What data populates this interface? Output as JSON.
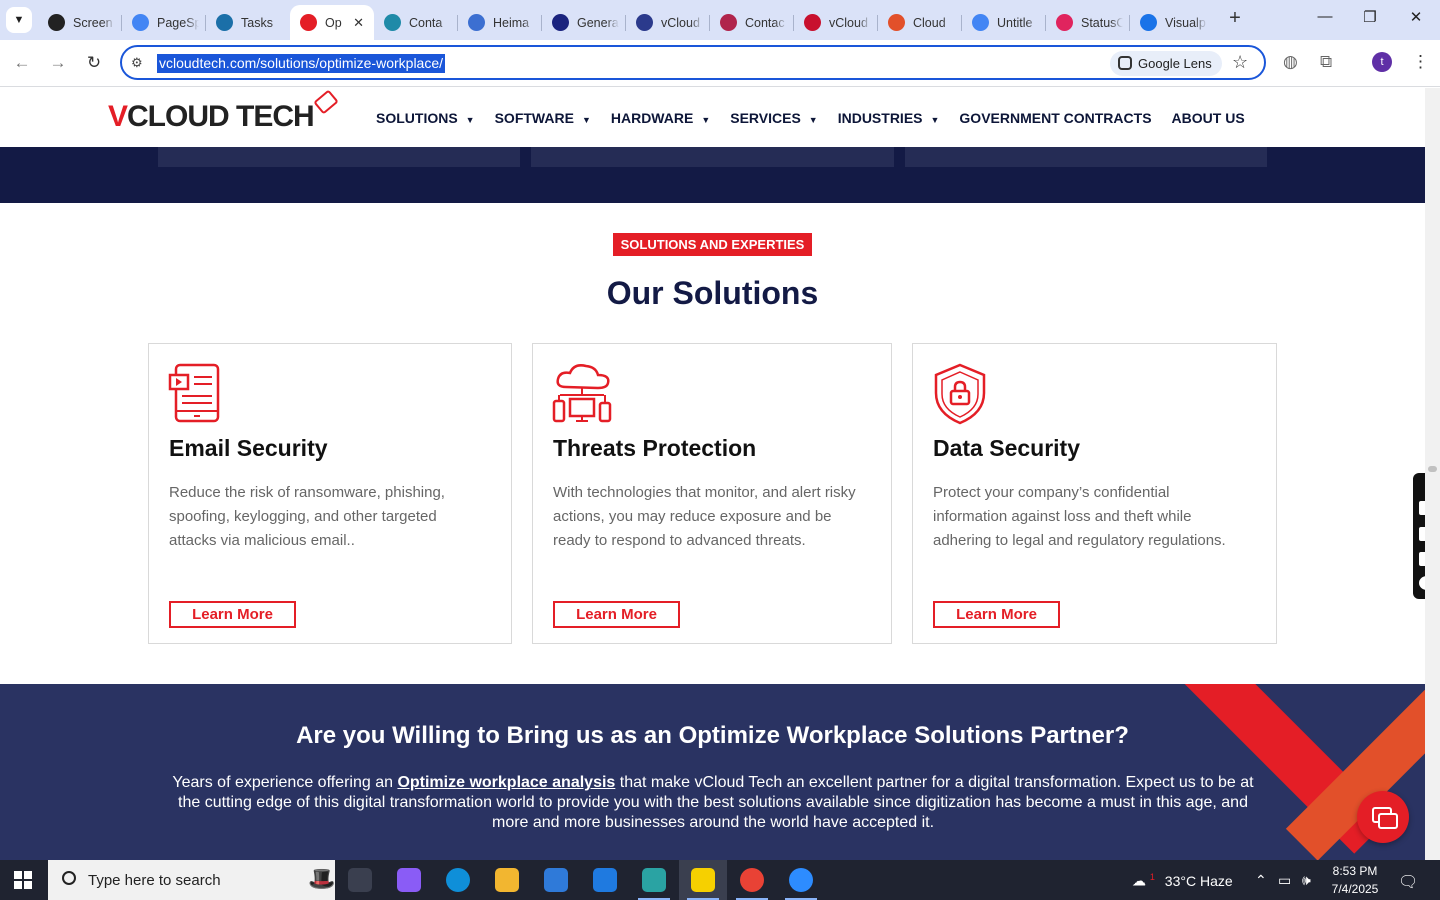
{
  "browser": {
    "tabs": [
      {
        "title": "Screen",
        "icon": "screencast-icon",
        "color": "#222222"
      },
      {
        "title": "PageSp",
        "icon": "pagespeed-icon",
        "color": "#4285f4"
      },
      {
        "title": "Tasks",
        "icon": "tasks-icon",
        "color": "#1b6fa8"
      },
      {
        "title": "Op",
        "icon": "vcloud-tech-icon",
        "color": "#e41e26",
        "active": true
      },
      {
        "title": "Conta",
        "icon": "contact-icon",
        "color": "#1f8aa8"
      },
      {
        "title": "Heima",
        "icon": "heimdal-icon",
        "color": "#3c6fd1"
      },
      {
        "title": "Genera",
        "icon": "generate-icon",
        "color": "#1a237e"
      },
      {
        "title": "vCloud",
        "icon": "vcloud-check-icon",
        "color": "#2b3a8c"
      },
      {
        "title": "Contac",
        "icon": "contact-form-icon",
        "color": "#b0244c"
      },
      {
        "title": "vCloud",
        "icon": "vcloud-v-icon",
        "color": "#c8102e"
      },
      {
        "title": "Cloud",
        "icon": "cloud-icon",
        "color": "#e2502a"
      },
      {
        "title": "Untitle",
        "icon": "docs-icon",
        "color": "#4285f4"
      },
      {
        "title": "StatusC",
        "icon": "statuscake-icon",
        "color": "#e0245e"
      },
      {
        "title": "Visualp",
        "icon": "visualping-icon",
        "color": "#1a73e8"
      }
    ],
    "close_tab": "✕",
    "new_tab": "+",
    "window_controls": {
      "minimize": "—",
      "maximize": "❐",
      "close": "✕"
    },
    "url": "vcloudtech.com/solutions/optimize-workplace/",
    "lens_label": "Google Lens",
    "profile_initial": "t"
  },
  "site": {
    "logo": {
      "v": "V",
      "rest": "CLOUD TECH"
    },
    "nav": [
      {
        "label": "SOLUTIONS",
        "dropdown": true
      },
      {
        "label": "SOFTWARE",
        "dropdown": true
      },
      {
        "label": "HARDWARE",
        "dropdown": true
      },
      {
        "label": "SERVICES",
        "dropdown": true
      },
      {
        "label": "INDUSTRIES",
        "dropdown": true
      },
      {
        "label": "GOVERNMENT CONTRACTS",
        "dropdown": false
      },
      {
        "label": "ABOUT US",
        "dropdown": false
      }
    ],
    "caret": "▼",
    "solutions": {
      "kicker": "SOLUTIONS AND EXPERTIES",
      "title": "Our Solutions",
      "cards": [
        {
          "title": "Email Security",
          "icon": "email-security-icon",
          "text": "Reduce the risk of ransomware, phishing, spoofing, keylogging, and other targeted attacks via malicious email..",
          "button": "Learn More"
        },
        {
          "title": "Threats Protection",
          "icon": "cloud-network-icon",
          "text": "With technologies that monitor, and alert risky actions, you may reduce exposure and be ready to respond to advanced threats.",
          "button": "Learn More"
        },
        {
          "title": "Data Security",
          "icon": "shield-lock-icon",
          "text": "Protect your company’s confidential information against loss and theft while adhering to legal and regulatory regulations.",
          "button": "Learn More"
        }
      ]
    },
    "cta": {
      "heading": "Are you Willing to Bring us as an Optimize Workplace Solutions Partner?",
      "text_before": "Years of experience offering an ",
      "link": "Optimize workplace analysis",
      "text_after": " that make vCloud Tech an excellent partner for a digital transformation. Expect us to be at the cutting edge of this digital transformation world to provide you with the best solutions available since digitization has become a must in this age, and more and more businesses around the world have accepted it."
    },
    "accent_color": "#e41e26",
    "navy_color": "#131a45"
  },
  "taskbar": {
    "search_placeholder": "Type here to search",
    "apps": [
      "task-view-icon",
      "copilot-icon",
      "edge-icon",
      "file-explorer-icon",
      "store-icon",
      "mail-icon",
      "app-icon",
      "sticky-notes-icon",
      "chrome-icon",
      "zoom-icon"
    ],
    "weather_badge": "1",
    "weather": "33°C  Haze",
    "time": "8:53 PM",
    "date": "7/4/2025"
  }
}
